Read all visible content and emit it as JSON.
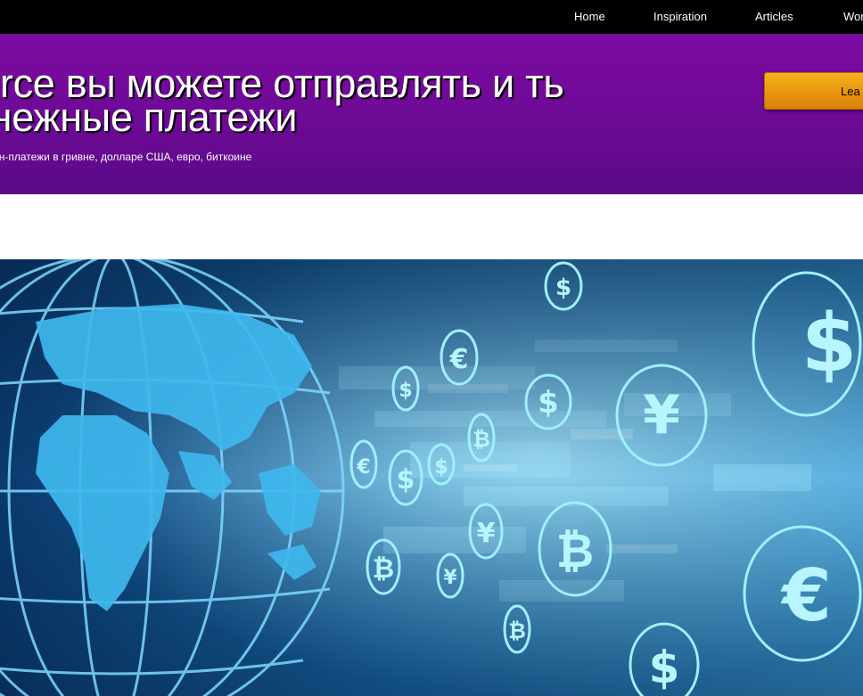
{
  "nav": {
    "items": [
      {
        "label": "Home"
      },
      {
        "label": "Inspiration"
      },
      {
        "label": "Articles"
      },
      {
        "label": "Wor"
      }
    ]
  },
  "hero": {
    "title": "merce вы можете отправлять и ть денежные платежи",
    "subtitle": "йн-платежи в гривне, долларе США, евро, биткоине",
    "button_label": "Lea"
  },
  "banner": {
    "currency_symbols": [
      "$",
      "€",
      "¥",
      "₿"
    ],
    "colors": {
      "deep": "#06284f",
      "mid": "#1a6fb0",
      "glow": "#7fe3ff",
      "continent": "#3fb8ee"
    }
  },
  "colors": {
    "nav_bg": "#000000",
    "hero_bg": "#7c0ba0",
    "button": "#f6b21b"
  }
}
